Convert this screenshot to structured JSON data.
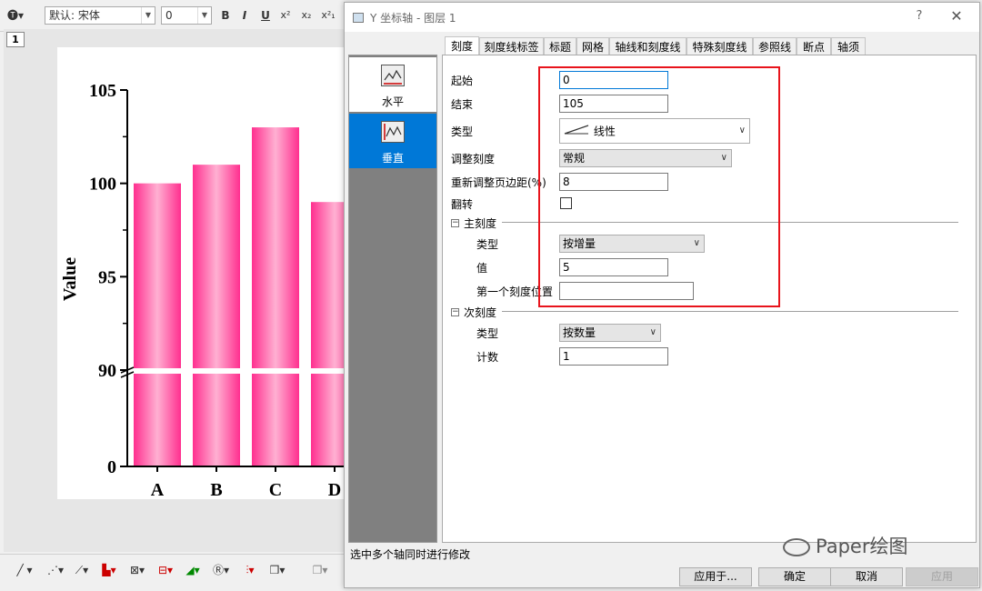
{
  "toolbar": {
    "font_combo": "默认: 宋体",
    "size_combo": "0",
    "bold": "B",
    "italic": "I",
    "underline": "U",
    "superscript": "x²",
    "subscript": "x₂",
    "supersub": "x²₁"
  },
  "graph": {
    "layer_number": "1",
    "chart_data": {
      "type": "bar",
      "categories": [
        "A",
        "B",
        "C",
        "D"
      ],
      "values": [
        100,
        101,
        103,
        99
      ],
      "ylabel": "Value",
      "yticks": [
        "105",
        "100",
        "95",
        "90",
        "0"
      ],
      "axis_break": [
        0,
        90
      ],
      "bar_color": "#ff4fa0"
    }
  },
  "dialog": {
    "title": "Y 坐标轴 - 图层 1",
    "help": "?",
    "close": "✕",
    "side_items": [
      {
        "label": "水平"
      },
      {
        "label": "垂直"
      }
    ],
    "tabs": [
      "刻度",
      "刻度线标签",
      "标题",
      "网格",
      "轴线和刻度线",
      "特殊刻度线",
      "参照线",
      "断点",
      "轴须"
    ],
    "form": {
      "start_label": "起始",
      "start_value": "0",
      "end_label": "结束",
      "end_value": "105",
      "type_label": "类型",
      "type_value": "线性",
      "rescale_label": "调整刻度",
      "rescale_value": "常规",
      "margin_label": "重新调整页边距(%)",
      "margin_value": "8",
      "flip_label": "翻转",
      "major_section": "主刻度",
      "major_type_label": "类型",
      "major_type_value": "按增量",
      "major_value_label": "值",
      "major_value": "5",
      "first_tick_label": "第一个刻度位置",
      "first_tick_value": "",
      "minor_section": "次刻度",
      "minor_type_label": "类型",
      "minor_type_value": "按数量",
      "minor_count_label": "计数",
      "minor_count_value": "1"
    },
    "status": "选中多个轴同时进行修改",
    "buttons": {
      "apply_to": "应用于...",
      "ok": "确定",
      "cancel": "取消",
      "apply": "应用"
    }
  },
  "watermark": "Paper绘图",
  "colors": {
    "accent": "#0078d7",
    "highlight_box": "#e8141c"
  }
}
